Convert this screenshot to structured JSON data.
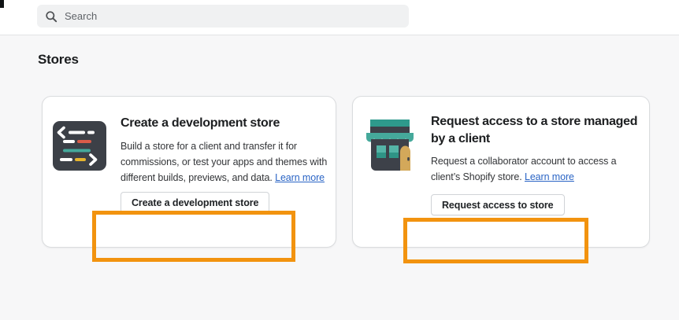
{
  "topbar": {
    "search_placeholder": "Search"
  },
  "page_title": "Stores",
  "cards": [
    {
      "icon": "code-terminal-icon",
      "title": "Create a development store",
      "body": "Build a store for a client and transfer it for commissions, or test your apps and themes with different builds, previews, and data.",
      "link_label": "Learn more",
      "button_label": "Create a development store"
    },
    {
      "icon": "storefront-icon",
      "title": "Request access to a store managed by a client",
      "body": "Request a collaborator account to access a client’s Shopify store.",
      "link_label": "Learn more",
      "button_label": "Request access to store"
    }
  ],
  "annotations": [
    {
      "shape": "rectangle",
      "color": "#F2930F",
      "target": "create-development-store-button"
    },
    {
      "shape": "rectangle",
      "color": "#F2930F",
      "target": "request-access-to-store-button"
    }
  ],
  "colors": {
    "annotation_orange": "#F2930F",
    "link_blue": "#2A64C5",
    "icon_dark_slate": "#3C4047",
    "icon_teal": "#45A99B",
    "icon_teal_dark": "#2E9A8C",
    "icon_red": "#D95B49",
    "icon_yellow": "#E5B42E",
    "icon_door_tan": "#D3A85A",
    "content_background": "#F7F7F8"
  }
}
